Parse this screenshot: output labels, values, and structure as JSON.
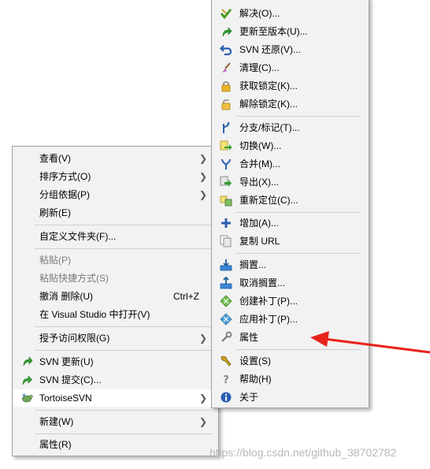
{
  "context_menu": {
    "items": [
      {
        "label": "查看(V)",
        "submenu": true
      },
      {
        "label": "排序方式(O)",
        "submenu": true
      },
      {
        "label": "分组依据(P)",
        "submenu": true
      },
      {
        "label": "刷新(E)"
      },
      {
        "label": "自定义文件夹(F)..."
      },
      {
        "label": "粘贴(P)",
        "disabled": true
      },
      {
        "label": "粘贴快捷方式(S)",
        "disabled": true
      },
      {
        "label": "撤消 删除(U)",
        "shortcut": "Ctrl+Z"
      },
      {
        "label": "在 Visual Studio 中打开(V)"
      },
      {
        "label": "授予访问权限(G)",
        "submenu": true
      },
      {
        "label": "SVN 更新(U)",
        "icon": "svn-update-icon"
      },
      {
        "label": "SVN 提交(C)...",
        "icon": "svn-commit-icon"
      },
      {
        "label": "TortoiseSVN",
        "icon": "tortoisesvn-icon",
        "submenu": true,
        "highlighted": true
      },
      {
        "label": "新建(W)",
        "submenu": true
      },
      {
        "label": "属性(R)"
      }
    ]
  },
  "submenu": {
    "items": [
      {
        "label": "解决(O)...",
        "icon": "resolve-icon"
      },
      {
        "label": "更新至版本(U)...",
        "icon": "update-to-revision-icon"
      },
      {
        "label": "SVN 还原(V)...",
        "icon": "revert-icon"
      },
      {
        "label": "清理(C)...",
        "icon": "cleanup-icon"
      },
      {
        "label": "获取锁定(K)...",
        "icon": "get-lock-icon"
      },
      {
        "label": "解除锁定(K)...",
        "icon": "release-lock-icon"
      },
      {
        "label": "分支/标记(T)...",
        "icon": "branch-tag-icon"
      },
      {
        "label": "切换(W)...",
        "icon": "switch-icon"
      },
      {
        "label": "合并(M)...",
        "icon": "merge-icon"
      },
      {
        "label": "导出(X)...",
        "icon": "export-icon"
      },
      {
        "label": "重新定位(C)...",
        "icon": "relocate-icon"
      },
      {
        "label": "增加(A)...",
        "icon": "add-icon"
      },
      {
        "label": "复制 URL",
        "icon": "copy-url-icon"
      },
      {
        "label": "搁置...",
        "icon": "shelve-icon"
      },
      {
        "label": "取消搁置...",
        "icon": "unshelve-icon"
      },
      {
        "label": "创建补丁(P)...",
        "icon": "create-patch-icon"
      },
      {
        "label": "应用补丁(P)...",
        "icon": "apply-patch-icon"
      },
      {
        "label": "属性",
        "icon": "properties-icon"
      },
      {
        "label": "设置(S)",
        "icon": "settings-icon"
      },
      {
        "label": "帮助(H)",
        "icon": "help-icon"
      },
      {
        "label": "关于",
        "icon": "about-icon"
      }
    ]
  },
  "watermark": "https://blog.csdn.net/github_38702782",
  "colors": {
    "annotation_arrow": "#e8231c",
    "menu_background": "#f2f2f2",
    "highlight": "#ffffff"
  }
}
